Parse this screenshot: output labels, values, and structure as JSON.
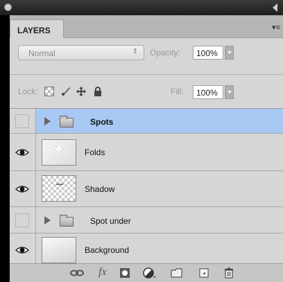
{
  "panel": {
    "tab_label": "LAYERS",
    "menu_glyph": "▾≡"
  },
  "blend": {
    "mode": "Normal",
    "arrows": "⇕"
  },
  "opacity": {
    "label": "Opacity:",
    "value": "100%"
  },
  "lock": {
    "label": "Lock:"
  },
  "fill": {
    "label": "Fill:",
    "value": "100%"
  },
  "layers": [
    {
      "name": "Spots",
      "type": "group",
      "visible": false,
      "selected": true
    },
    {
      "name": "Folds",
      "type": "layer",
      "visible": true,
      "selected": false
    },
    {
      "name": "Shadow",
      "type": "layer",
      "visible": true,
      "selected": false
    },
    {
      "name": "Spot under",
      "type": "group",
      "visible": false,
      "selected": false
    },
    {
      "name": "Background",
      "type": "layer",
      "visible": true,
      "selected": false
    }
  ],
  "colors": {
    "selection": "#a8c8f4",
    "panel": "#d6d6d6"
  },
  "footer_icons": [
    "link-icon",
    "fx-icon",
    "mask-icon",
    "adjustment-icon",
    "new-group-icon",
    "new-layer-icon",
    "trash-icon"
  ],
  "footer": {
    "fx_label": "fx"
  }
}
